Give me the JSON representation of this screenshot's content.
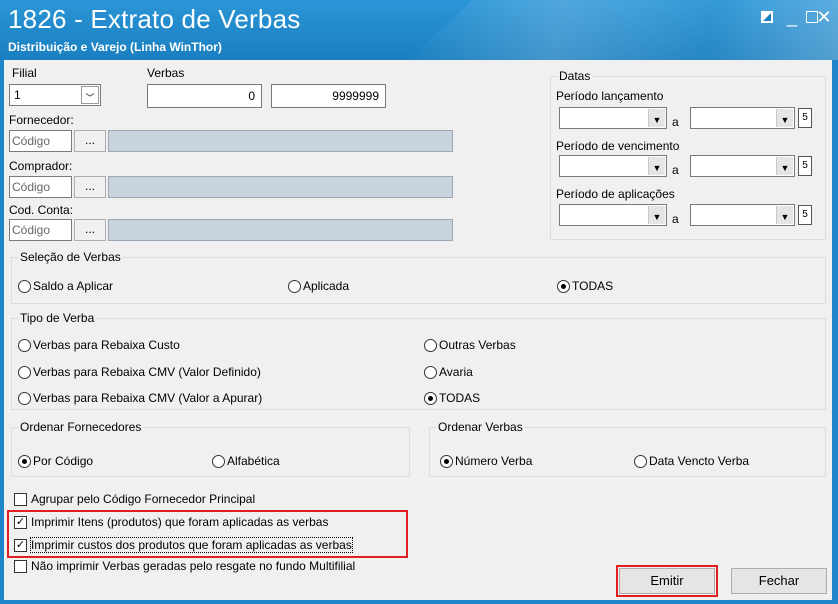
{
  "window": {
    "title": "1826 - Extrato de Verbas",
    "subtitle": "Distribuição e Varejo (Linha WinThor)"
  },
  "filial": {
    "label": "Filial",
    "value": "1"
  },
  "verbas": {
    "label": "Verbas",
    "from": "0",
    "to": "9999999"
  },
  "fornecedor": {
    "label": "Fornecedor:",
    "placeholder": "Código",
    "browse": "..."
  },
  "comprador": {
    "label": "Comprador:",
    "placeholder": "Código",
    "browse": "..."
  },
  "conta": {
    "label": "Cod. Conta:",
    "placeholder": "Código",
    "browse": "..."
  },
  "datas": {
    "legend": "Datas",
    "sep": "a",
    "lancamento": "Período lançamento",
    "vencimento": "Período de vencimento",
    "aplicacoes": "Período de aplicações"
  },
  "selecao": {
    "legend": "Seleção de Verbas",
    "options": [
      "Saldo a Aplicar",
      "Aplicada",
      "TODAS"
    ],
    "selected": "TODAS"
  },
  "tipo": {
    "legend": "Tipo de Verba",
    "options": [
      "Verbas para Rebaixa Custo",
      "Verbas para Rebaixa CMV (Valor Definido)",
      "Verbas para Rebaixa CMV (Valor a Apurar)",
      "Outras Verbas",
      "Avaria",
      "TODAS"
    ],
    "selected": "TODAS"
  },
  "ordem_fornecedores": {
    "legend": "Ordenar Fornecedores",
    "options": [
      "Por Código",
      "Alfabética"
    ],
    "selected": "Por Código"
  },
  "ordem_verbas": {
    "legend": "Ordenar Verbas",
    "options": [
      "Número Verba",
      "Data Vencto Verba"
    ],
    "selected": "Número Verba"
  },
  "checks": [
    {
      "label": "Agrupar pelo Código Fornecedor Principal",
      "checked": false
    },
    {
      "label": "Imprimir Itens (produtos) que foram aplicadas as verbas",
      "checked": true
    },
    {
      "label": "Imprimir custos dos produtos que foram aplicadas as verbas",
      "checked": true
    },
    {
      "label": "Não imprimir Verbas geradas pelo resgate no fundo Multifilial",
      "checked": false
    }
  ],
  "buttons": {
    "emitir": "Emitir",
    "fechar": "Fechar"
  },
  "colors": {
    "titlebar": "#1e86c8",
    "highlight": "#e02020",
    "client": "#f0f0f0"
  }
}
